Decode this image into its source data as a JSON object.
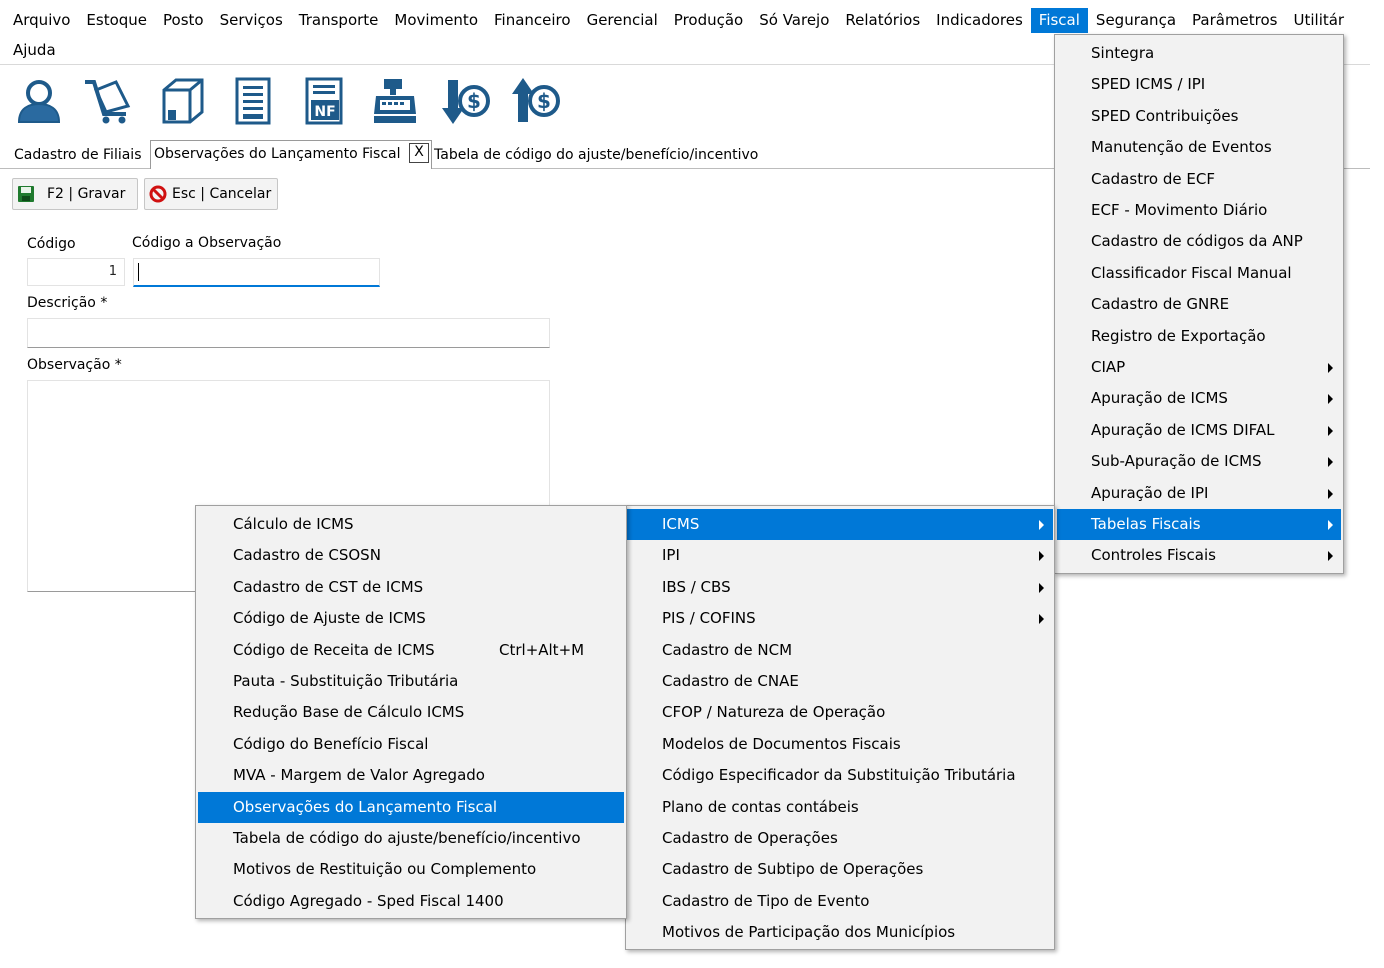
{
  "menubar": {
    "items": [
      "Arquivo",
      "Estoque",
      "Posto",
      "Serviços",
      "Transporte",
      "Movimento",
      "Financeiro",
      "Gerencial",
      "Produção",
      "Só Varejo",
      "Relatórios",
      "Indicadores",
      "Fiscal",
      "Segurança",
      "Parâmetros",
      "Utilitár"
    ],
    "help": "Ajuda"
  },
  "toolbar": {
    "icons": [
      "user-icon",
      "cart-icon",
      "box-icon",
      "document-icon",
      "nf-document-icon",
      "cash-register-icon",
      "payable-icon",
      "receivable-icon"
    ]
  },
  "tabs": {
    "items": [
      "Cadastro de Filiais",
      "Observações do Lançamento Fiscal",
      "Tabela de código do ajuste/benefício/incentivo"
    ],
    "close": "X"
  },
  "actions": {
    "save_label": "F2 | Gravar",
    "cancel_label": "Esc | Cancelar"
  },
  "form": {
    "codigo_label": "Código",
    "codigo_value": "1",
    "codigo_obs_label": "Código a Observação",
    "codigo_obs_value": "",
    "descricao_label": "Descrição *",
    "descricao_value": "",
    "observacao_label": "Observação *",
    "observacao_value": ""
  },
  "fiscal_menu": [
    {
      "label": "Sintegra",
      "sub": false
    },
    {
      "label": "SPED ICMS / IPI",
      "sub": false
    },
    {
      "label": "SPED Contribuições",
      "sub": false
    },
    {
      "label": "Manutenção de Eventos",
      "sub": false
    },
    {
      "label": "Cadastro de ECF",
      "sub": false
    },
    {
      "label": "ECF - Movimento Diário",
      "sub": false
    },
    {
      "label": "Cadastro de códigos da ANP",
      "sub": false
    },
    {
      "label": "Classificador Fiscal Manual",
      "sub": false
    },
    {
      "label": "Cadastro de GNRE",
      "sub": false
    },
    {
      "label": "Registro de Exportação",
      "sub": false
    },
    {
      "label": "CIAP",
      "sub": true
    },
    {
      "label": "Apuração de ICMS",
      "sub": true
    },
    {
      "label": "Apuração de ICMS DIFAL",
      "sub": true
    },
    {
      "label": "Sub-Apuração de ICMS",
      "sub": true
    },
    {
      "label": "Apuração de IPI",
      "sub": true
    },
    {
      "label": "Tabelas Fiscais",
      "sub": true,
      "highlighted": true
    },
    {
      "label": "Controles Fiscais",
      "sub": true
    }
  ],
  "tabelas_menu": [
    {
      "label": "ICMS",
      "sub": true,
      "highlighted": true
    },
    {
      "label": "IPI",
      "sub": true
    },
    {
      "label": "IBS / CBS",
      "sub": true
    },
    {
      "label": "PIS / COFINS",
      "sub": true
    },
    {
      "label": "Cadastro de NCM",
      "sub": false
    },
    {
      "label": "Cadastro de CNAE",
      "sub": false
    },
    {
      "label": "CFOP / Natureza de Operação",
      "sub": false
    },
    {
      "label": "Modelos de Documentos Fiscais",
      "sub": false
    },
    {
      "label": "Código Especificador da Substituição Tributária",
      "sub": false
    },
    {
      "label": "Plano de contas contábeis",
      "sub": false
    },
    {
      "label": "Cadastro de Operações",
      "sub": false
    },
    {
      "label": "Cadastro de Subtipo de Operações",
      "sub": false
    },
    {
      "label": "Cadastro de Tipo de Evento",
      "sub": false
    },
    {
      "label": "Motivos de Participação dos Municípios",
      "sub": false
    }
  ],
  "icms_menu": [
    {
      "label": "Cálculo de ICMS",
      "shortcut": ""
    },
    {
      "label": "Cadastro de CSOSN",
      "shortcut": ""
    },
    {
      "label": "Cadastro de CST de ICMS",
      "shortcut": ""
    },
    {
      "label": "Código de Ajuste de ICMS",
      "shortcut": ""
    },
    {
      "label": "Código de Receita de ICMS",
      "shortcut": "Ctrl+Alt+M"
    },
    {
      "label": "Pauta - Substituição Tributária",
      "shortcut": ""
    },
    {
      "label": "Redução Base de Cálculo ICMS",
      "shortcut": ""
    },
    {
      "label": "Código do Benefício Fiscal",
      "shortcut": ""
    },
    {
      "label": "MVA - Margem de Valor Agregado",
      "shortcut": ""
    },
    {
      "label": "Observações do Lançamento Fiscal",
      "shortcut": "",
      "highlighted": true
    },
    {
      "label": "Tabela de código do ajuste/benefício/incentivo",
      "shortcut": ""
    },
    {
      "label": "Motivos de Restituição ou Complemento",
      "shortcut": ""
    },
    {
      "label": "Código Agregado - Sped Fiscal 1400",
      "shortcut": ""
    }
  ],
  "colors": {
    "accent": "#0078d7",
    "menu_bg": "#f2f2f2",
    "icon_blue": "#1e5a8a"
  }
}
